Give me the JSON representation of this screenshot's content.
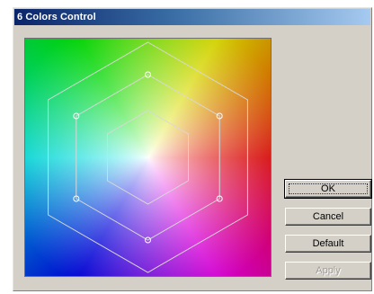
{
  "window": {
    "title": "6 Colors Control"
  },
  "buttons": {
    "ok_label": "OK",
    "cancel_label": "Cancel",
    "default_label": "Default",
    "apply_label": "Apply"
  },
  "colors": {
    "face": "#d4d0c8",
    "titlebar_start": "#0a246a",
    "titlebar_end": "#a6caf0",
    "guide_line": "#d8d8d8"
  },
  "icons": [
    "hexagon-guides",
    "control-point-handles"
  ]
}
